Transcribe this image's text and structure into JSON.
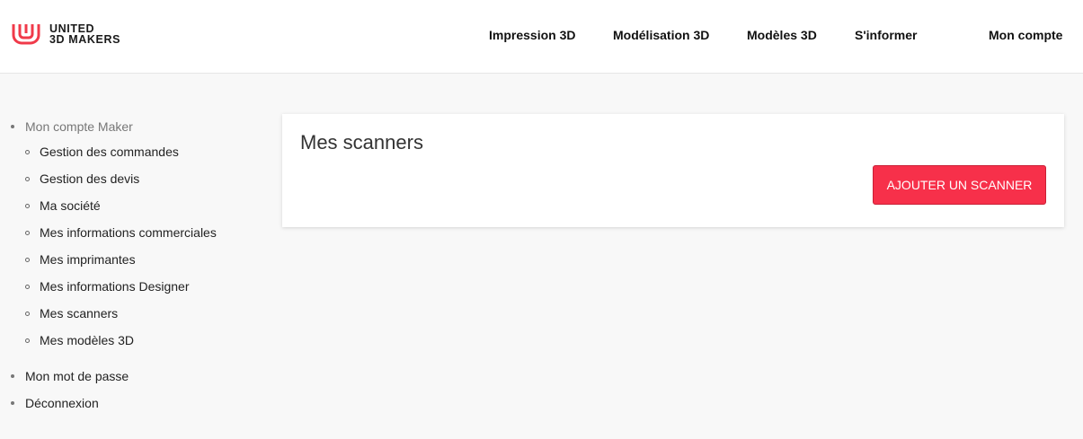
{
  "brand": {
    "line1": "UNITED",
    "line2": "3D MAKERS",
    "accent_color": "#f03a4a"
  },
  "nav": [
    {
      "label": "Impression 3D"
    },
    {
      "label": "Modélisation 3D"
    },
    {
      "label": "Modèles 3D"
    },
    {
      "label": "S'informer"
    },
    {
      "label": "Mon compte"
    }
  ],
  "sidebar": {
    "section": "Mon compte Maker",
    "items": [
      {
        "label": "Gestion des commandes"
      },
      {
        "label": "Gestion des devis"
      },
      {
        "label": "Ma société"
      },
      {
        "label": "Mes informations commerciales"
      },
      {
        "label": "Mes imprimantes"
      },
      {
        "label": "Mes informations Designer"
      },
      {
        "label": "Mes scanners"
      },
      {
        "label": "Mes modèles 3D"
      }
    ],
    "password": "Mon mot de passe",
    "logout": "Déconnexion"
  },
  "main": {
    "title": "Mes scanners",
    "add_button": "AJOUTER UN SCANNER",
    "button_color": "#f7304a"
  }
}
